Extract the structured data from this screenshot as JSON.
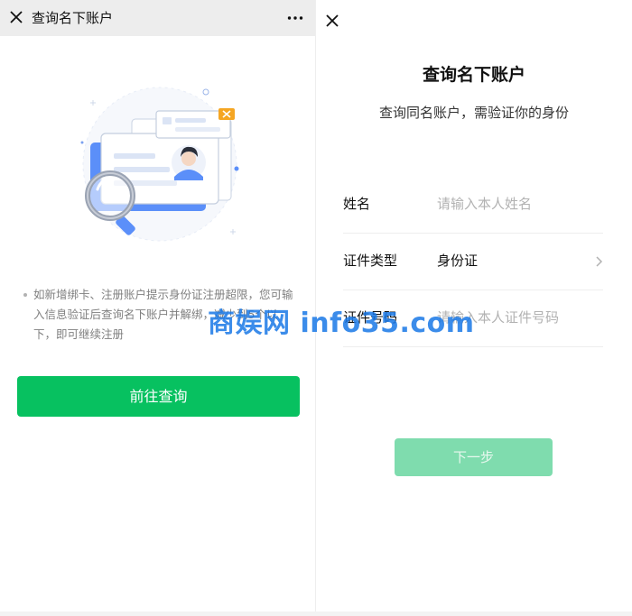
{
  "left": {
    "header": {
      "title": "查询名下账户",
      "close_icon": "close-icon",
      "more_icon": "more-dots-icon"
    },
    "illustration": "id-card-magnifier-illustration",
    "notice": "如新增绑卡、注册账户提示身份证注册超限，您可输入信息验证后查询名下账户并解绑，减少到5个以下，即可继续注册",
    "primary_button": "前往查询"
  },
  "right": {
    "close_icon": "close-icon",
    "title": "查询名下账户",
    "subtitle": "查询同名账户，需验证你的身份",
    "form": {
      "name": {
        "label": "姓名",
        "placeholder": "请输入本人姓名"
      },
      "id_type": {
        "label": "证件类型",
        "value": "身份证",
        "icon": "chevron-right-icon"
      },
      "id_number": {
        "label": "证件号码",
        "placeholder": "请输入本人证件号码"
      }
    },
    "next_button": "下一步"
  },
  "watermark": "商娱网 info35.com",
  "colors": {
    "brand_green": "#07c160",
    "disabled_green": "#7fdcae",
    "header_bg": "#ededed",
    "illustration_blue": "#5b8ff9",
    "badge_orange": "#f5a623",
    "watermark_blue": "#1978e6"
  }
}
